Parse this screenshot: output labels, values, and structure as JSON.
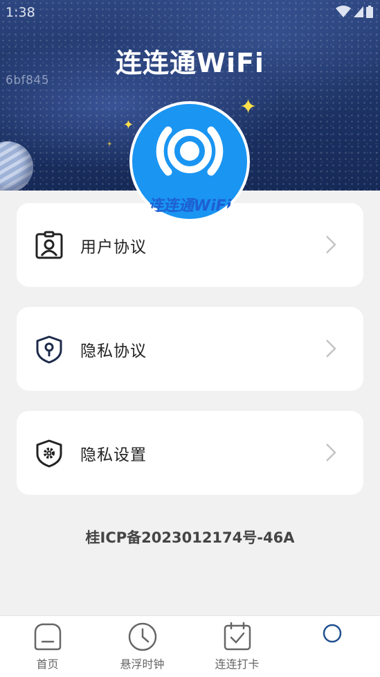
{
  "status_bar": {
    "time": "1:38"
  },
  "header": {
    "watermark": "6bf845",
    "title": "连连通WiFi",
    "logo_text": "连连通WiFi"
  },
  "menu": {
    "items": [
      {
        "label": "用户协议",
        "icon": "user-badge-icon"
      },
      {
        "label": "隐私协议",
        "icon": "privacy-shield-icon"
      },
      {
        "label": "隐私设置",
        "icon": "settings-shield-icon"
      }
    ]
  },
  "footer": {
    "icp": "桂ICP备2023012174号-46A"
  },
  "bottom_nav": {
    "items": [
      {
        "label": "首页",
        "icon": "home-icon"
      },
      {
        "label": "悬浮时钟",
        "icon": "clock-icon"
      },
      {
        "label": "连连打卡",
        "icon": "calendar-check-icon"
      },
      {
        "label": "",
        "icon": "profile-circle-icon"
      }
    ]
  },
  "colors": {
    "accent": "#1a95f2",
    "nav_active": "#1f4f8f",
    "page_background": "#f1f1f1",
    "hero_background": "#1e3466"
  }
}
